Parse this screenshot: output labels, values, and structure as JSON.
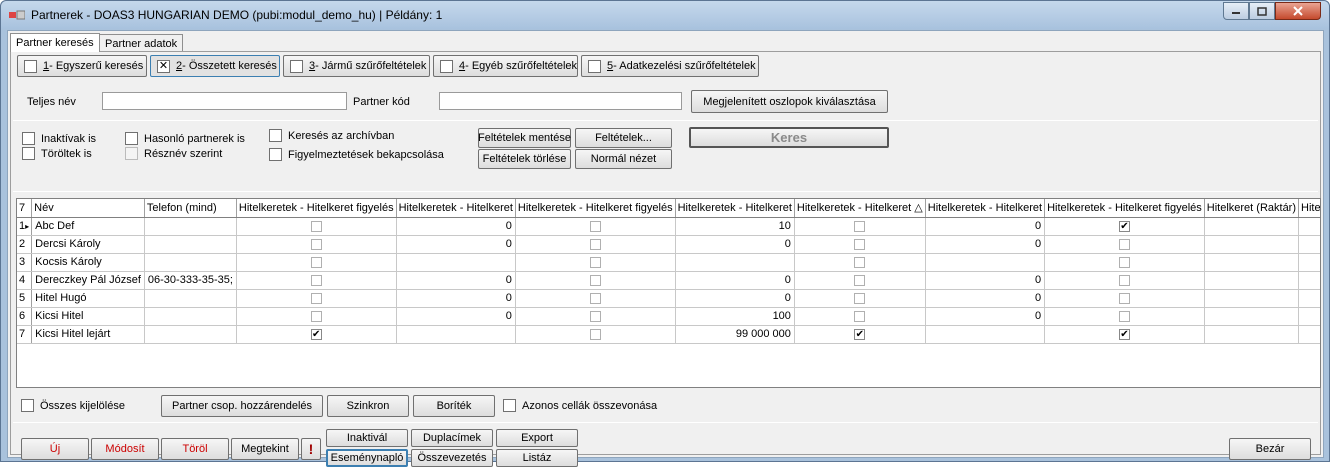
{
  "window": {
    "title": "Partnerek - DOAS3 HUNGARIAN DEMO (pubi:modul_demo_hu) | Példány: 1"
  },
  "tabs": [
    {
      "label": "Partner keresés"
    },
    {
      "label": "Partner adatok"
    }
  ],
  "search_modes": [
    {
      "key": "1",
      "label": " - Egyszerű keresés",
      "checked": false
    },
    {
      "key": "2",
      "label": " - Összetett keresés",
      "checked": true
    },
    {
      "key": "3",
      "label": " - Jármű szűrőfeltételek",
      "checked": false
    },
    {
      "key": "4",
      "label": " - Egyéb szűrőfeltételek",
      "checked": false
    },
    {
      "key": "5",
      "label": " - Adatkezelési szűrőfeltételek",
      "checked": false
    }
  ],
  "fields": {
    "full_name_label": "Teljes név",
    "full_name_value": "",
    "partner_code_label": "Partner kód",
    "partner_code_value": "",
    "select_columns_button": "Megjelenített oszlopok kiválasztása"
  },
  "filters": {
    "inactive": "Inaktívak is",
    "deleted": "Töröltek is",
    "similar": "Hasonló partnerek is",
    "partial_name": "Résznév szerint",
    "archive": "Keresés az archívban",
    "warnings": "Figyelmeztetések bekapcsolása",
    "save_conditions": "Feltételek mentése",
    "conditions": "Feltételek...",
    "delete_conditions": "Feltételek törlése",
    "normal_view": "Normál nézet",
    "search": "Keres"
  },
  "grid": {
    "corner": "7",
    "columns": [
      "Név",
      "Telefon (mind)",
      "Hitelkeretek - Hitelkeret figyelés",
      "Hitelkeretek - Hitelkeret",
      "Hitelkeretek - Hitelkeret figyelés",
      "Hitelkeretek - Hitelkeret",
      "Hitelkeretek - Hitelkeret △",
      "Hitelkeretek - Hitelkeret",
      "Hitelkeretek - Hitelkeret figyelés",
      "Hitelkeret (Raktár)",
      "Hitelkeretek - Lejárt"
    ],
    "rows": [
      {
        "n": "1",
        "marker": "▸",
        "name": "Abc Def",
        "phone": "",
        "c1": false,
        "v1": "0",
        "c2": false,
        "v2": "10",
        "c3": false,
        "v3": "0",
        "c4": true,
        "v4": "",
        "c5": false
      },
      {
        "n": "2",
        "marker": "",
        "name": "Dercsi Károly",
        "phone": "",
        "c1": false,
        "v1": "0",
        "c2": false,
        "v2": "0",
        "c3": false,
        "v3": "0",
        "c4": false,
        "v4": "",
        "c5": false
      },
      {
        "n": "3",
        "marker": "",
        "name": "Kocsis Károly",
        "phone": "",
        "c1": false,
        "v1": "",
        "c2": false,
        "v2": "",
        "c3": false,
        "v3": "",
        "c4": false,
        "v4": "",
        "c5": false
      },
      {
        "n": "4",
        "marker": "",
        "name": "Dereczkey Pál József",
        "phone": "06-30-333-35-35;",
        "c1": false,
        "v1": "0",
        "c2": false,
        "v2": "0",
        "c3": false,
        "v3": "0",
        "c4": false,
        "v4": "",
        "c5": false
      },
      {
        "n": "5",
        "marker": "",
        "name": "Hitel Hugó",
        "phone": "",
        "c1": false,
        "v1": "0",
        "c2": false,
        "v2": "0",
        "c3": false,
        "v3": "0",
        "c4": false,
        "v4": "",
        "c5": false
      },
      {
        "n": "6",
        "marker": "",
        "name": "Kicsi Hitel",
        "phone": "",
        "c1": false,
        "v1": "0",
        "c2": false,
        "v2": "100",
        "c3": false,
        "v3": "0",
        "c4": false,
        "v4": "",
        "c5": false
      },
      {
        "n": "7",
        "marker": "",
        "name": "Kicsi Hitel lejárt",
        "phone": "",
        "c1": true,
        "v1": "",
        "c2": false,
        "v2": "99 000 000",
        "c3": true,
        "v3": "",
        "c4": true,
        "v4": "",
        "c5": false
      }
    ]
  },
  "bottom": {
    "select_all": "Összes kijelölése",
    "assign_group": "Partner csop. hozzárendelés",
    "sync": "Szinkron",
    "envelope": "Boríték",
    "merge_cells": "Azonos cellák összevonása"
  },
  "actions": {
    "new": "Új",
    "modify": "Módosít",
    "delete": "Töröl",
    "view": "Megtekint",
    "alert": "!",
    "deactivate": "Inaktivál",
    "event_log": "Eseménynapló",
    "duplicates": "Duplacímek",
    "merge": "Összevezetés",
    "export": "Export",
    "list": "Listáz",
    "close": "Bezár"
  }
}
